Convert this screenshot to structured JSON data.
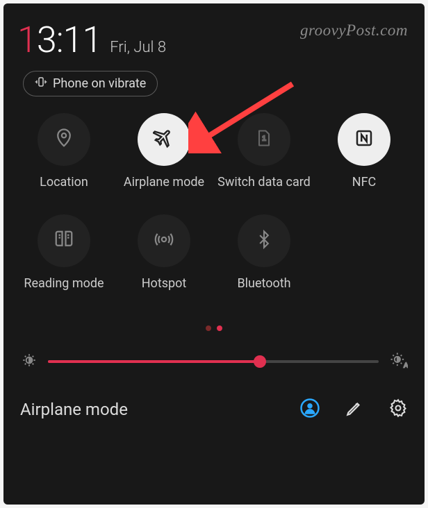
{
  "watermark": "groovyPost.com",
  "clock": {
    "hour_first": "1",
    "rest": "3:11"
  },
  "date": "Fri, Jul 8",
  "vibrate_label": "Phone on vibrate",
  "tiles": [
    {
      "label": "Location",
      "icon": "location-icon",
      "active": false
    },
    {
      "label": "Airplane mode",
      "icon": "airplane-icon",
      "active": true
    },
    {
      "label": "Switch data card",
      "icon": "sim-icon",
      "active": false
    },
    {
      "label": "NFC",
      "icon": "nfc-icon",
      "active": true
    },
    {
      "label": "Reading mode",
      "icon": "book-icon",
      "active": false
    },
    {
      "label": "Hotspot",
      "icon": "hotspot-icon",
      "active": false
    },
    {
      "label": "Bluetooth",
      "icon": "bluetooth-icon",
      "active": false
    }
  ],
  "pagination": {
    "count": 2,
    "active": 1
  },
  "brightness": {
    "percent": 64
  },
  "bottom": {
    "title": "Airplane mode",
    "user_icon": "user-icon",
    "edit_icon": "pencil-icon",
    "settings_icon": "gear-icon"
  },
  "colors": {
    "accent": "#e03050",
    "bg": "#181818",
    "tile_active": "#eeeeee"
  }
}
